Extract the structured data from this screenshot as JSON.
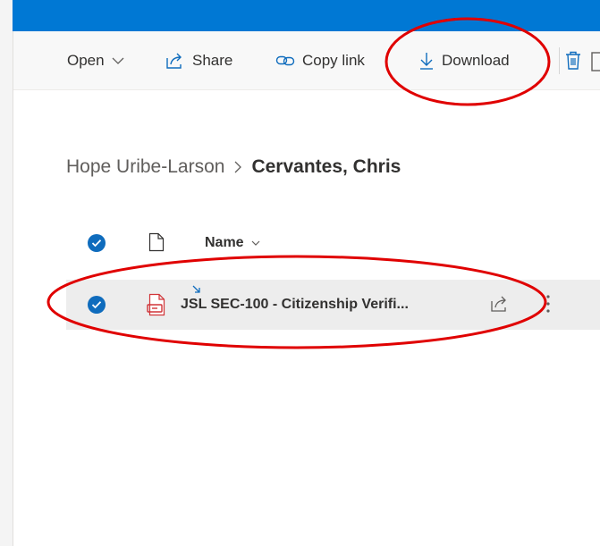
{
  "command_bar": {
    "open_label": "Open",
    "share_label": "Share",
    "copy_link_label": "Copy link",
    "download_label": "Download"
  },
  "breadcrumb": {
    "parent": "Hope Uribe-Larson",
    "current": "Cervantes, Chris"
  },
  "file_list": {
    "column_name": "Name",
    "rows": [
      {
        "name": "JSL SEC-100 - Citizenship Verifi...",
        "selected": true,
        "file_type": "pdf",
        "recently_shared": true
      }
    ]
  },
  "colors": {
    "top_bar": "#0078d4",
    "check": "#0f6cbd",
    "pdf": "#d13438",
    "annotation": "#e00000",
    "row_selected": "#ededed"
  },
  "icons": {
    "open_chevron": "chevron-down-icon",
    "share": "share-icon",
    "copy_link": "link-icon",
    "download": "download-icon",
    "delete": "trash-icon",
    "file_header": "document-icon",
    "file": "pdf-file-icon"
  }
}
